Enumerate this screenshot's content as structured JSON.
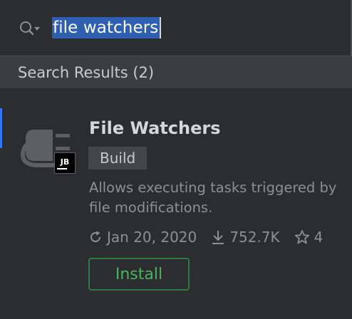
{
  "search": {
    "query": "file watchers"
  },
  "results": {
    "header": "Search Results (2)"
  },
  "plugin": {
    "name": "File Watchers",
    "tag": "Build",
    "description": "Allows executing tasks triggered by file modifications.",
    "date": "Jan 20, 2020",
    "downloads": "752.7K",
    "rating": "4",
    "install_label": "Install",
    "vendor_badge": "JB"
  },
  "colors": {
    "background": "#2b2d30",
    "selection": "#2f5fb0",
    "install_border": "#2f7a42",
    "install_text": "#49b45e",
    "accent": "#3574f0"
  },
  "icons": [
    "search-icon",
    "dropdown-arrow-icon",
    "plugin-plug-icon",
    "refresh-icon",
    "download-icon",
    "star-icon"
  ]
}
